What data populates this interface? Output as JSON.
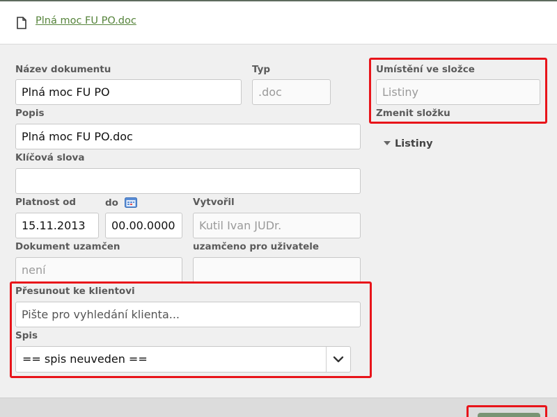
{
  "header": {
    "doc_link": "Plná moc FU PO.doc",
    "icon": "document-icon"
  },
  "form": {
    "name_label": "Název dokumentu",
    "name_value": "Plná moc FU PO",
    "type_label": "Typ",
    "type_value": ".doc",
    "desc_label": "Popis",
    "desc_value": "Plná moc FU PO.doc",
    "keywords_label": "Klíčová slova",
    "keywords_value": "",
    "valid_from_label": "Platnost od",
    "valid_from_value": "15.11.2013",
    "valid_to_label": "do",
    "valid_to_value": "00.00.0000",
    "created_by_label": "Vytvořil",
    "created_by_value": "Kutil Ivan  JUDr.",
    "locked_label": "Dokument uzamčen",
    "locked_value": "není",
    "locked_for_label": "uzamčeno pro uživatele",
    "locked_for_value": "",
    "move_client_label": "Přesunout ke klientovi",
    "move_client_placeholder": "Pište pro vyhledání klienta...",
    "file_label": "Spis",
    "file_value": "== spis neuveden =="
  },
  "folder": {
    "location_label": "Umístění ve složce",
    "location_value": "Listiny",
    "change_label": "Zmenit složku",
    "tree_item": "Listiny"
  },
  "colors": {
    "accent": "#55833a",
    "highlight": "#e8141a"
  }
}
